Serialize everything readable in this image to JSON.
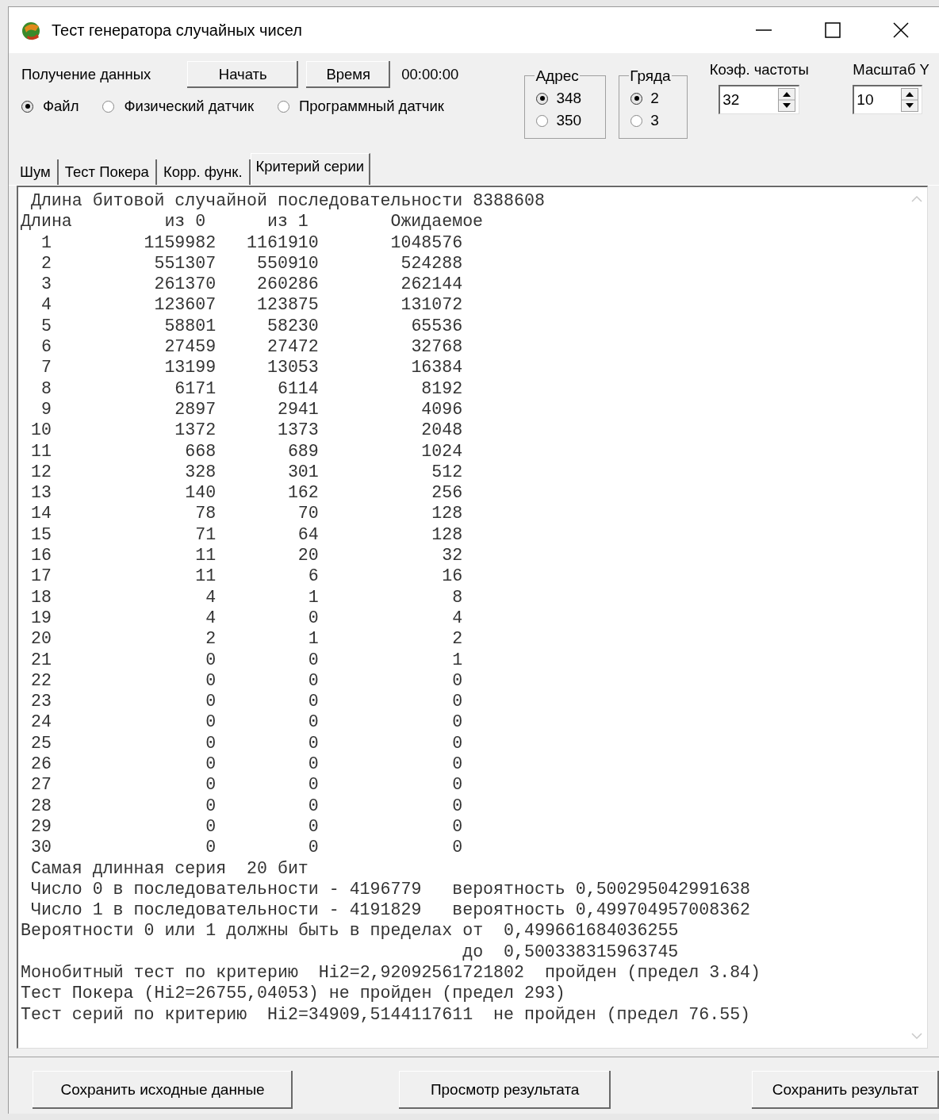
{
  "window": {
    "title": "Тест генератора случайных чисел"
  },
  "source": {
    "label": "Получение данных",
    "buttons": [
      "Начать",
      "Время"
    ],
    "time": "00:00:00",
    "options": [
      {
        "label": "Файл",
        "selected": true
      },
      {
        "label": "Физический датчик",
        "selected": false
      },
      {
        "label": "Программный датчик",
        "selected": false
      }
    ]
  },
  "groups": [
    {
      "title": "Адрес",
      "options": [
        {
          "label": "348",
          "selected": true
        },
        {
          "label": "350",
          "selected": false
        }
      ]
    },
    {
      "title": "Гряда",
      "options": [
        {
          "label": "2",
          "selected": true
        },
        {
          "label": "3",
          "selected": false
        }
      ]
    }
  ],
  "spinners": [
    {
      "label": "Коэф. частоты",
      "value": "32"
    },
    {
      "label": "Масштаб Y",
      "value": "10"
    }
  ],
  "tabs": [
    {
      "label": "Шум",
      "selected": false
    },
    {
      "label": "Тест Покера",
      "selected": false
    },
    {
      "label": "Корр. функ.",
      "selected": false
    },
    {
      "label": "Критерий серии",
      "selected": true
    }
  ],
  "report": {
    "title_line": "Длина битовой случайной последовательности 8388608",
    "columns": [
      "Длина",
      "из 0",
      "из 1",
      "Ожидаемое"
    ],
    "rows": [
      [
        "1",
        "1159982",
        "1161910",
        "1048576"
      ],
      [
        "2",
        "551307",
        "550910",
        "524288"
      ],
      [
        "3",
        "261370",
        "260286",
        "262144"
      ],
      [
        "4",
        "123607",
        "123875",
        "131072"
      ],
      [
        "5",
        "58801",
        "58230",
        "65536"
      ],
      [
        "6",
        "27459",
        "27472",
        "32768"
      ],
      [
        "7",
        "13199",
        "13053",
        "16384"
      ],
      [
        "8",
        "6171",
        "6114",
        "8192"
      ],
      [
        "9",
        "2897",
        "2941",
        "4096"
      ],
      [
        "10",
        "1372",
        "1373",
        "2048"
      ],
      [
        "11",
        "668",
        "689",
        "1024"
      ],
      [
        "12",
        "328",
        "301",
        "512"
      ],
      [
        "13",
        "140",
        "162",
        "256"
      ],
      [
        "14",
        "78",
        "70",
        "128"
      ],
      [
        "15",
        "71",
        "64",
        "128"
      ],
      [
        "16",
        "11",
        "20",
        "32"
      ],
      [
        "17",
        "11",
        "6",
        "16"
      ],
      [
        "18",
        "4",
        "1",
        "8"
      ],
      [
        "19",
        "4",
        "0",
        "4"
      ],
      [
        "20",
        "2",
        "1",
        "2"
      ],
      [
        "21",
        "0",
        "0",
        "1"
      ],
      [
        "22",
        "0",
        "0",
        "0"
      ],
      [
        "23",
        "0",
        "0",
        "0"
      ],
      [
        "24",
        "0",
        "0",
        "0"
      ],
      [
        "25",
        "0",
        "0",
        "0"
      ],
      [
        "26",
        "0",
        "0",
        "0"
      ],
      [
        "27",
        "0",
        "0",
        "0"
      ],
      [
        "28",
        "0",
        "0",
        "0"
      ],
      [
        "29",
        "0",
        "0",
        "0"
      ],
      [
        "30",
        "0",
        "0",
        "0"
      ]
    ],
    "footer": [
      {
        "kind": "indent",
        "text": "Самая длинная серия  20 бит"
      },
      {
        "kind": "indent",
        "text": "Число 0 в последовательности - 4196779   вероятность 0,500295042991638"
      },
      {
        "kind": "indent",
        "text": "Число 1 в последовательности - 4191829   вероятность 0,499704957008362"
      },
      {
        "kind": "plain",
        "text": "Вероятности 0 или 1 должны быть в пределах от  0,499661684036255"
      },
      {
        "kind": "continuation",
        "text": "до  0,500338315963745"
      },
      {
        "kind": "plain",
        "text": "Монобитный тест по критерию  Hi2=2,92092561721802  пройден (предел 3.84)"
      },
      {
        "kind": "plain",
        "text": "Тест Покера (Hi2=26755,04053) не пройден (предел 293)"
      },
      {
        "kind": "plain",
        "text": "Тест серий по критерию  Hi2=34909,5144117611  не пройден (предел 76.55)"
      }
    ]
  },
  "buttons": [
    "Сохранить исходные данные",
    "Просмотр результата",
    "Сохранить результат"
  ]
}
